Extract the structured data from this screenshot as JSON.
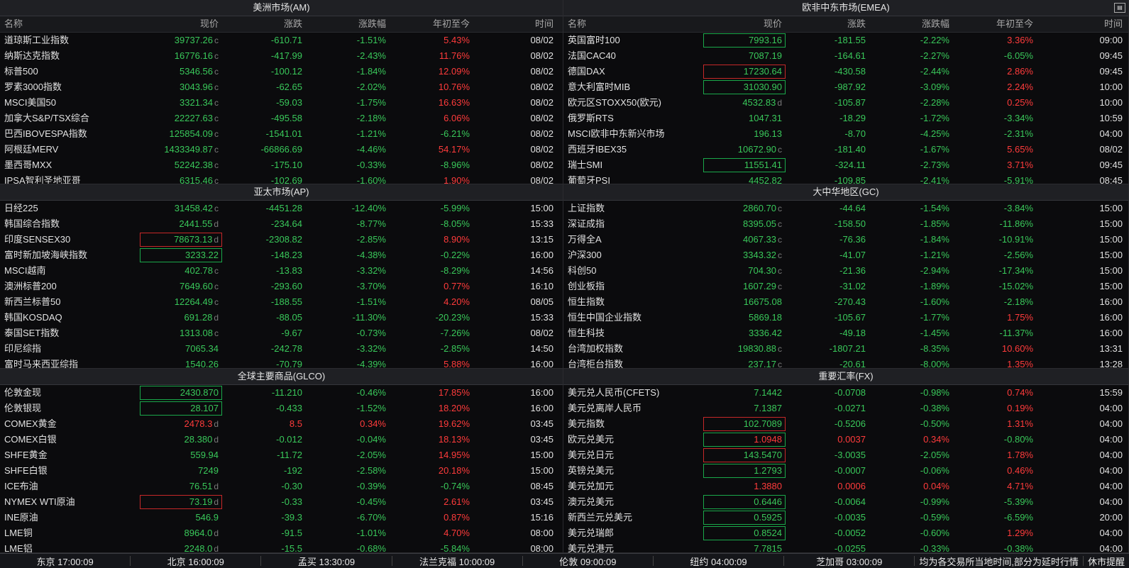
{
  "panels": [
    {
      "title": "美洲市场(AM)",
      "headers": [
        "名称",
        "现价",
        "涨跌",
        "涨跌幅",
        "年初至今",
        "时间"
      ],
      "rows": [
        {
          "name": "道琼斯工业指数",
          "price": "39737.26",
          "sfx": "c",
          "chg": "-610.71",
          "pct": "-1.51%",
          "ytd": "5.43%",
          "time": "08/02",
          "pc": "g",
          "cc": "g",
          "yc": "r",
          "box": ""
        },
        {
          "name": "纳斯达克指数",
          "price": "16776.16",
          "sfx": "c",
          "chg": "-417.99",
          "pct": "-2.43%",
          "ytd": "11.76%",
          "time": "08/02",
          "pc": "g",
          "cc": "g",
          "yc": "r",
          "box": ""
        },
        {
          "name": "标普500",
          "price": "5346.56",
          "sfx": "c",
          "chg": "-100.12",
          "pct": "-1.84%",
          "ytd": "12.09%",
          "time": "08/02",
          "pc": "g",
          "cc": "g",
          "yc": "r",
          "box": ""
        },
        {
          "name": "罗素3000指数",
          "price": "3043.96",
          "sfx": "c",
          "chg": "-62.65",
          "pct": "-2.02%",
          "ytd": "10.76%",
          "time": "08/02",
          "pc": "g",
          "cc": "g",
          "yc": "r",
          "box": ""
        },
        {
          "name": "MSCI美国50",
          "price": "3321.34",
          "sfx": "c",
          "chg": "-59.03",
          "pct": "-1.75%",
          "ytd": "16.63%",
          "time": "08/02",
          "pc": "g",
          "cc": "g",
          "yc": "r",
          "box": ""
        },
        {
          "name": "加拿大S&P/TSX综合",
          "price": "22227.63",
          "sfx": "c",
          "chg": "-495.58",
          "pct": "-2.18%",
          "ytd": "6.06%",
          "time": "08/02",
          "pc": "g",
          "cc": "g",
          "yc": "r",
          "box": ""
        },
        {
          "name": "巴西IBOVESPA指数",
          "price": "125854.09",
          "sfx": "c",
          "chg": "-1541.01",
          "pct": "-1.21%",
          "ytd": "-6.21%",
          "time": "08/02",
          "pc": "g",
          "cc": "g",
          "yc": "g",
          "box": ""
        },
        {
          "name": "阿根廷MERV",
          "price": "1433349.87",
          "sfx": "c",
          "chg": "-66866.69",
          "pct": "-4.46%",
          "ytd": "54.17%",
          "time": "08/02",
          "pc": "g",
          "cc": "g",
          "yc": "r",
          "box": ""
        },
        {
          "name": "墨西哥MXX",
          "price": "52242.38",
          "sfx": "c",
          "chg": "-175.10",
          "pct": "-0.33%",
          "ytd": "-8.96%",
          "time": "08/02",
          "pc": "g",
          "cc": "g",
          "yc": "g",
          "box": ""
        },
        {
          "name": "IPSA智利圣地亚哥",
          "price": "6315.46",
          "sfx": "c",
          "chg": "-102.69",
          "pct": "-1.60%",
          "ytd": "1.90%",
          "time": "08/02",
          "pc": "g",
          "cc": "g",
          "yc": "r",
          "box": ""
        }
      ]
    },
    {
      "title": "欧非中东市场(EMEA)",
      "headers": [
        "名称",
        "现价",
        "涨跌",
        "涨跌幅",
        "年初至今",
        "时间"
      ],
      "rows": [
        {
          "name": "英国富时100",
          "price": "7993.16",
          "sfx": "",
          "chg": "-181.55",
          "pct": "-2.22%",
          "ytd": "3.36%",
          "time": "09:00",
          "pc": "g",
          "cc": "g",
          "yc": "r",
          "box": "boxg"
        },
        {
          "name": "法国CAC40",
          "price": "7087.19",
          "sfx": "",
          "chg": "-164.61",
          "pct": "-2.27%",
          "ytd": "-6.05%",
          "time": "09:45",
          "pc": "g",
          "cc": "g",
          "yc": "g",
          "box": ""
        },
        {
          "name": "德国DAX",
          "price": "17230.64",
          "sfx": "",
          "chg": "-430.58",
          "pct": "-2.44%",
          "ytd": "2.86%",
          "time": "09:45",
          "pc": "g",
          "cc": "g",
          "yc": "r",
          "box": "boxr"
        },
        {
          "name": "意大利富时MIB",
          "price": "31030.90",
          "sfx": "",
          "chg": "-987.92",
          "pct": "-3.09%",
          "ytd": "2.24%",
          "time": "10:00",
          "pc": "g",
          "cc": "g",
          "yc": "r",
          "box": "boxg"
        },
        {
          "name": "欧元区STOXX50(欧元)",
          "price": "4532.83",
          "sfx": "d",
          "chg": "-105.87",
          "pct": "-2.28%",
          "ytd": "0.25%",
          "time": "10:00",
          "pc": "g",
          "cc": "g",
          "yc": "r",
          "box": ""
        },
        {
          "name": "俄罗斯RTS",
          "price": "1047.31",
          "sfx": "",
          "chg": "-18.29",
          "pct": "-1.72%",
          "ytd": "-3.34%",
          "time": "10:59",
          "pc": "g",
          "cc": "g",
          "yc": "g",
          "box": ""
        },
        {
          "name": "MSCI欧非中东新兴市场",
          "price": "196.13",
          "sfx": "",
          "chg": "-8.70",
          "pct": "-4.25%",
          "ytd": "-2.31%",
          "time": "04:00",
          "pc": "g",
          "cc": "g",
          "yc": "g",
          "box": ""
        },
        {
          "name": "西班牙IBEX35",
          "price": "10672.90",
          "sfx": "c",
          "chg": "-181.40",
          "pct": "-1.67%",
          "ytd": "5.65%",
          "time": "08/02",
          "pc": "g",
          "cc": "g",
          "yc": "r",
          "box": ""
        },
        {
          "name": "瑞士SMI",
          "price": "11551.41",
          "sfx": "",
          "chg": "-324.11",
          "pct": "-2.73%",
          "ytd": "3.71%",
          "time": "09:45",
          "pc": "g",
          "cc": "g",
          "yc": "r",
          "box": "boxg"
        },
        {
          "name": "葡萄牙PSI",
          "price": "4452.82",
          "sfx": "",
          "chg": "-109.85",
          "pct": "-2.41%",
          "ytd": "-5.91%",
          "time": "08:45",
          "pc": "g",
          "cc": "g",
          "yc": "g",
          "box": ""
        }
      ]
    },
    {
      "title": "亚太市场(AP)",
      "headers": [],
      "rows": [
        {
          "name": "日经225",
          "price": "31458.42",
          "sfx": "c",
          "chg": "-4451.28",
          "pct": "-12.40%",
          "ytd": "-5.99%",
          "time": "15:00",
          "pc": "g",
          "cc": "g",
          "yc": "g",
          "box": ""
        },
        {
          "name": "韩国综合指数",
          "price": "2441.55",
          "sfx": "d",
          "chg": "-234.64",
          "pct": "-8.77%",
          "ytd": "-8.05%",
          "time": "15:33",
          "pc": "g",
          "cc": "g",
          "yc": "g",
          "box": ""
        },
        {
          "name": "印度SENSEX30",
          "price": "78673.13",
          "sfx": "d",
          "chg": "-2308.82",
          "pct": "-2.85%",
          "ytd": "8.90%",
          "time": "13:15",
          "pc": "g",
          "cc": "g",
          "yc": "r",
          "box": "boxr"
        },
        {
          "name": "富时新加坡海峡指数",
          "price": "3233.22",
          "sfx": "",
          "chg": "-148.23",
          "pct": "-4.38%",
          "ytd": "-0.22%",
          "time": "16:00",
          "pc": "g",
          "cc": "g",
          "yc": "g",
          "box": "boxg"
        },
        {
          "name": "MSCI越南",
          "price": "402.78",
          "sfx": "c",
          "chg": "-13.83",
          "pct": "-3.32%",
          "ytd": "-8.29%",
          "time": "14:56",
          "pc": "g",
          "cc": "g",
          "yc": "g",
          "box": ""
        },
        {
          "name": "澳洲标普200",
          "price": "7649.60",
          "sfx": "c",
          "chg": "-293.60",
          "pct": "-3.70%",
          "ytd": "0.77%",
          "time": "16:10",
          "pc": "g",
          "cc": "g",
          "yc": "r",
          "box": ""
        },
        {
          "name": "新西兰标普50",
          "price": "12264.49",
          "sfx": "c",
          "chg": "-188.55",
          "pct": "-1.51%",
          "ytd": "4.20%",
          "time": "08/05",
          "pc": "g",
          "cc": "g",
          "yc": "r",
          "box": ""
        },
        {
          "name": "韩国KOSDAQ",
          "price": "691.28",
          "sfx": "d",
          "chg": "-88.05",
          "pct": "-11.30%",
          "ytd": "-20.23%",
          "time": "15:33",
          "pc": "g",
          "cc": "g",
          "yc": "g",
          "box": ""
        },
        {
          "name": "泰国SET指数",
          "price": "1313.08",
          "sfx": "c",
          "chg": "-9.67",
          "pct": "-0.73%",
          "ytd": "-7.26%",
          "time": "08/02",
          "pc": "g",
          "cc": "g",
          "yc": "g",
          "box": ""
        },
        {
          "name": "印尼综指",
          "price": "7065.34",
          "sfx": "",
          "chg": "-242.78",
          "pct": "-3.32%",
          "ytd": "-2.85%",
          "time": "14:50",
          "pc": "g",
          "cc": "g",
          "yc": "g",
          "box": ""
        },
        {
          "name": "富时马来西亚综指",
          "price": "1540.26",
          "sfx": "",
          "chg": "-70.79",
          "pct": "-4.39%",
          "ytd": "5.88%",
          "time": "16:00",
          "pc": "g",
          "cc": "g",
          "yc": "r",
          "box": ""
        }
      ]
    },
    {
      "title": "大中华地区(GC)",
      "headers": [],
      "rows": [
        {
          "name": "上证指数",
          "price": "2860.70",
          "sfx": "c",
          "chg": "-44.64",
          "pct": "-1.54%",
          "ytd": "-3.84%",
          "time": "15:00",
          "pc": "g",
          "cc": "g",
          "yc": "g",
          "box": ""
        },
        {
          "name": "深证成指",
          "price": "8395.05",
          "sfx": "c",
          "chg": "-158.50",
          "pct": "-1.85%",
          "ytd": "-11.86%",
          "time": "15:00",
          "pc": "g",
          "cc": "g",
          "yc": "g",
          "box": ""
        },
        {
          "name": "万得全A",
          "price": "4067.33",
          "sfx": "c",
          "chg": "-76.36",
          "pct": "-1.84%",
          "ytd": "-10.91%",
          "time": "15:00",
          "pc": "g",
          "cc": "g",
          "yc": "g",
          "box": ""
        },
        {
          "name": "沪深300",
          "price": "3343.32",
          "sfx": "c",
          "chg": "-41.07",
          "pct": "-1.21%",
          "ytd": "-2.56%",
          "time": "15:00",
          "pc": "g",
          "cc": "g",
          "yc": "g",
          "box": ""
        },
        {
          "name": "科创50",
          "price": "704.30",
          "sfx": "c",
          "chg": "-21.36",
          "pct": "-2.94%",
          "ytd": "-17.34%",
          "time": "15:00",
          "pc": "g",
          "cc": "g",
          "yc": "g",
          "box": ""
        },
        {
          "name": "创业板指",
          "price": "1607.29",
          "sfx": "c",
          "chg": "-31.02",
          "pct": "-1.89%",
          "ytd": "-15.02%",
          "time": "15:00",
          "pc": "g",
          "cc": "g",
          "yc": "g",
          "box": ""
        },
        {
          "name": "恒生指数",
          "price": "16675.08",
          "sfx": "",
          "chg": "-270.43",
          "pct": "-1.60%",
          "ytd": "-2.18%",
          "time": "16:00",
          "pc": "g",
          "cc": "g",
          "yc": "g",
          "box": ""
        },
        {
          "name": "恒生中国企业指数",
          "price": "5869.18",
          "sfx": "",
          "chg": "-105.67",
          "pct": "-1.77%",
          "ytd": "1.75%",
          "time": "16:00",
          "pc": "g",
          "cc": "g",
          "yc": "r",
          "box": ""
        },
        {
          "name": "恒生科技",
          "price": "3336.42",
          "sfx": "",
          "chg": "-49.18",
          "pct": "-1.45%",
          "ytd": "-11.37%",
          "time": "16:00",
          "pc": "g",
          "cc": "g",
          "yc": "g",
          "box": ""
        },
        {
          "name": "台湾加权指数",
          "price": "19830.88",
          "sfx": "c",
          "chg": "-1807.21",
          "pct": "-8.35%",
          "ytd": "10.60%",
          "time": "13:31",
          "pc": "g",
          "cc": "g",
          "yc": "r",
          "box": ""
        },
        {
          "name": "台湾柜台指数",
          "price": "237.17",
          "sfx": "c",
          "chg": "-20.61",
          "pct": "-8.00%",
          "ytd": "1.35%",
          "time": "13:28",
          "pc": "g",
          "cc": "g",
          "yc": "r",
          "box": ""
        }
      ]
    },
    {
      "title": "全球主要商品(GLCO)",
      "headers": [],
      "rows": [
        {
          "name": "伦敦金现",
          "price": "2430.870",
          "sfx": "",
          "chg": "-11.210",
          "pct": "-0.46%",
          "ytd": "17.85%",
          "time": "16:00",
          "pc": "g",
          "cc": "g",
          "yc": "r",
          "box": "boxg"
        },
        {
          "name": "伦敦银现",
          "price": "28.107",
          "sfx": "",
          "chg": "-0.433",
          "pct": "-1.52%",
          "ytd": "18.20%",
          "time": "16:00",
          "pc": "g",
          "cc": "g",
          "yc": "r",
          "box": "boxg"
        },
        {
          "name": "COMEX黄金",
          "price": "2478.3",
          "sfx": "d",
          "chg": "8.5",
          "pct": "0.34%",
          "ytd": "19.62%",
          "time": "03:45",
          "pc": "r",
          "cc": "r",
          "yc": "r",
          "box": ""
        },
        {
          "name": "COMEX白银",
          "price": "28.380",
          "sfx": "d",
          "chg": "-0.012",
          "pct": "-0.04%",
          "ytd": "18.13%",
          "time": "03:45",
          "pc": "g",
          "cc": "g",
          "yc": "r",
          "box": ""
        },
        {
          "name": "SHFE黄金",
          "price": "559.94",
          "sfx": "",
          "chg": "-11.72",
          "pct": "-2.05%",
          "ytd": "14.95%",
          "time": "15:00",
          "pc": "g",
          "cc": "g",
          "yc": "r",
          "box": ""
        },
        {
          "name": "SHFE白银",
          "price": "7249",
          "sfx": "",
          "chg": "-192",
          "pct": "-2.58%",
          "ytd": "20.18%",
          "time": "15:00",
          "pc": "g",
          "cc": "g",
          "yc": "r",
          "box": ""
        },
        {
          "name": "ICE布油",
          "price": "76.51",
          "sfx": "d",
          "chg": "-0.30",
          "pct": "-0.39%",
          "ytd": "-0.74%",
          "time": "08:45",
          "pc": "g",
          "cc": "g",
          "yc": "g",
          "box": ""
        },
        {
          "name": "NYMEX WTI原油",
          "price": "73.19",
          "sfx": "d",
          "chg": "-0.33",
          "pct": "-0.45%",
          "ytd": "2.61%",
          "time": "03:45",
          "pc": "g",
          "cc": "g",
          "yc": "r",
          "box": "boxr"
        },
        {
          "name": "INE原油",
          "price": "546.9",
          "sfx": "",
          "chg": "-39.3",
          "pct": "-6.70%",
          "ytd": "0.87%",
          "time": "15:16",
          "pc": "g",
          "cc": "g",
          "yc": "r",
          "box": ""
        },
        {
          "name": "LME铜",
          "price": "8964.0",
          "sfx": "d",
          "chg": "-91.5",
          "pct": "-1.01%",
          "ytd": "4.70%",
          "time": "08:00",
          "pc": "g",
          "cc": "g",
          "yc": "r",
          "box": ""
        },
        {
          "name": "LME铝",
          "price": "2248.0",
          "sfx": "d",
          "chg": "-15.5",
          "pct": "-0.68%",
          "ytd": "-5.84%",
          "time": "08:00",
          "pc": "g",
          "cc": "g",
          "yc": "g",
          "box": ""
        }
      ]
    },
    {
      "title": "重要汇率(FX)",
      "headers": [],
      "rows": [
        {
          "name": "美元兑人民币(CFETS)",
          "price": "7.1442",
          "sfx": "",
          "chg": "-0.0708",
          "pct": "-0.98%",
          "ytd": "0.74%",
          "time": "15:59",
          "pc": "g",
          "cc": "g",
          "yc": "r",
          "box": ""
        },
        {
          "name": "美元兑离岸人民币",
          "price": "7.1387",
          "sfx": "",
          "chg": "-0.0271",
          "pct": "-0.38%",
          "ytd": "0.19%",
          "time": "04:00",
          "pc": "g",
          "cc": "g",
          "yc": "r",
          "box": ""
        },
        {
          "name": "美元指数",
          "price": "102.7089",
          "sfx": "",
          "chg": "-0.5206",
          "pct": "-0.50%",
          "ytd": "1.31%",
          "time": "04:00",
          "pc": "g",
          "cc": "g",
          "yc": "r",
          "box": "boxr"
        },
        {
          "name": "欧元兑美元",
          "price": "1.0948",
          "sfx": "",
          "chg": "0.0037",
          "pct": "0.34%",
          "ytd": "-0.80%",
          "time": "04:00",
          "pc": "r",
          "cc": "r",
          "yc": "g",
          "box": "boxg"
        },
        {
          "name": "美元兑日元",
          "price": "143.5470",
          "sfx": "",
          "chg": "-3.0035",
          "pct": "-2.05%",
          "ytd": "1.78%",
          "time": "04:00",
          "pc": "g",
          "cc": "g",
          "yc": "r",
          "box": "boxr"
        },
        {
          "name": "英镑兑美元",
          "price": "1.2793",
          "sfx": "",
          "chg": "-0.0007",
          "pct": "-0.06%",
          "ytd": "0.46%",
          "time": "04:00",
          "pc": "g",
          "cc": "g",
          "yc": "r",
          "box": "boxg"
        },
        {
          "name": "美元兑加元",
          "price": "1.3880",
          "sfx": "",
          "chg": "0.0006",
          "pct": "0.04%",
          "ytd": "4.71%",
          "time": "04:00",
          "pc": "r",
          "cc": "r",
          "yc": "r",
          "box": ""
        },
        {
          "name": "澳元兑美元",
          "price": "0.6446",
          "sfx": "",
          "chg": "-0.0064",
          "pct": "-0.99%",
          "ytd": "-5.39%",
          "time": "04:00",
          "pc": "g",
          "cc": "g",
          "yc": "g",
          "box": "boxg"
        },
        {
          "name": "新西兰元兑美元",
          "price": "0.5925",
          "sfx": "",
          "chg": "-0.0035",
          "pct": "-0.59%",
          "ytd": "-6.59%",
          "time": "20:00",
          "pc": "g",
          "cc": "g",
          "yc": "g",
          "box": "boxg"
        },
        {
          "name": "美元兑瑞郎",
          "price": "0.8524",
          "sfx": "",
          "chg": "-0.0052",
          "pct": "-0.60%",
          "ytd": "1.29%",
          "time": "04:00",
          "pc": "g",
          "cc": "g",
          "yc": "r",
          "box": "boxg"
        },
        {
          "name": "美元兑港元",
          "price": "7.7815",
          "sfx": "",
          "chg": "-0.0255",
          "pct": "-0.33%",
          "ytd": "-0.38%",
          "time": "04:00",
          "pc": "g",
          "cc": "g",
          "yc": "g",
          "box": ""
        }
      ]
    }
  ],
  "footer": {
    "clocks": [
      "东京 17:00:09",
      "北京 16:00:09",
      "孟买 13:30:09",
      "法兰克福 10:00:09",
      "伦敦 09:00:09",
      "纽约 04:00:09",
      "芝加哥 03:00:09"
    ],
    "note": "均为各交易所当地时间,部分为延时行情",
    "close_hint": "休市提醒"
  },
  "colors": {
    "up": "#ff3b3b",
    "down": "#39c85a",
    "bg": "#000000"
  },
  "icons": {
    "panel_corner": "panel-export-icon"
  }
}
